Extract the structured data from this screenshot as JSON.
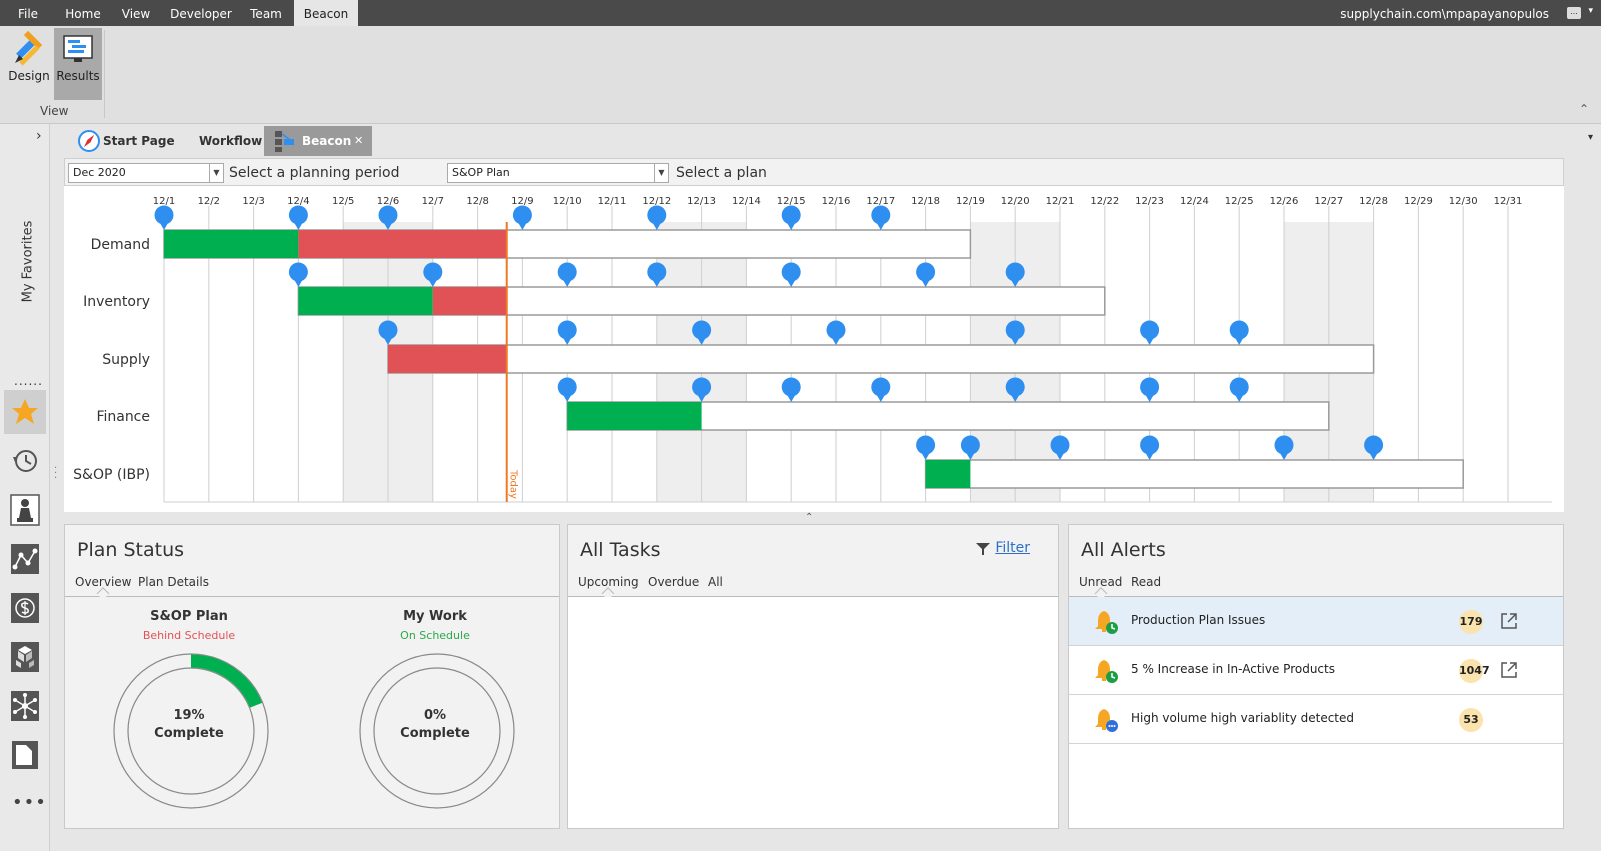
{
  "menu": {
    "items": [
      {
        "label": "File"
      },
      {
        "label": "Home"
      },
      {
        "label": "View"
      },
      {
        "label": "Developer"
      },
      {
        "label": "Team"
      },
      {
        "label": "Beacon"
      }
    ],
    "active": "Beacon",
    "user": "supplychain.com\\mpapayanopulos",
    "user_button": "...",
    "user_caret": "▾"
  },
  "ribbon": {
    "buttons": [
      {
        "label": "Design",
        "icon": "design-icon"
      },
      {
        "label": "Results",
        "icon": "results-icon",
        "selected": true
      }
    ],
    "group_label": "View",
    "collapse_glyph": "⌃"
  },
  "left_rail": {
    "expand_glyph": "›",
    "favorites_label": "My Favorites",
    "dots": "......",
    "icons": [
      "star-icon",
      "history-icon",
      "chess-pawn-icon",
      "network-graph-icon",
      "dollar-cycle-icon",
      "boxes-icon",
      "hub-icon",
      "document-icon"
    ],
    "more": "•••"
  },
  "doc_tabs": {
    "tabs": [
      {
        "label": "Start Page",
        "icon": "compass-icon"
      },
      {
        "label": "Workflow"
      },
      {
        "label": "Beacon",
        "icon": "beacon-icon",
        "selected": true,
        "closable": true
      }
    ],
    "close_glyph": "✕",
    "overflow_caret": "▾"
  },
  "selectors": {
    "period_value": "Dec 2020",
    "period_hint": "Select a planning period",
    "plan_value": "S&OP Plan",
    "plan_hint": "Select a plan",
    "dropdown_glyph": "▼"
  },
  "gantt": {
    "dates": [
      "12/1",
      "12/2",
      "12/3",
      "12/4",
      "12/5",
      "12/6",
      "12/7",
      "12/8",
      "12/9",
      "12/10",
      "12/11",
      "12/12",
      "12/13",
      "12/14",
      "12/15",
      "12/16",
      "12/17",
      "12/18",
      "12/19",
      "12/20",
      "12/21",
      "12/22",
      "12/23",
      "12/24",
      "12/25",
      "12/26",
      "12/27",
      "12/28",
      "12/29",
      "12/30",
      "12/31"
    ],
    "weekend_days": [
      5,
      6,
      12,
      13,
      19,
      20,
      26,
      27
    ],
    "today_day": 8.65,
    "today_label": "Today",
    "colors": {
      "on_track": "#00b050",
      "behind": "#e05256",
      "milestone": "#2e8ff0",
      "today": "#f07820"
    },
    "rows": [
      {
        "label": "Demand",
        "start": 1,
        "end": 19,
        "done": [
          [
            1,
            4
          ]
        ],
        "late": [
          [
            4,
            8.65
          ]
        ],
        "milestones": [
          1,
          4,
          6,
          9,
          12,
          15,
          17
        ]
      },
      {
        "label": "Inventory",
        "start": 4,
        "end": 22,
        "done": [
          [
            4,
            7
          ]
        ],
        "late": [
          [
            7,
            8.65
          ]
        ],
        "milestones": [
          4,
          7,
          10,
          12,
          15,
          18,
          20
        ]
      },
      {
        "label": "Supply",
        "start": 6,
        "end": 28,
        "done": [],
        "late": [
          [
            6,
            8.65
          ]
        ],
        "milestones": [
          6,
          10,
          13,
          16,
          20,
          23,
          25
        ]
      },
      {
        "label": "Finance",
        "start": 10,
        "end": 27,
        "done": [
          [
            10,
            13
          ]
        ],
        "late": [],
        "milestones": [
          10,
          13,
          15,
          17,
          20,
          23,
          25
        ]
      },
      {
        "label": "S&OP (IBP)",
        "start": 18,
        "end": 30,
        "done": [
          [
            18,
            19
          ]
        ],
        "late": [],
        "milestones": [
          18,
          19,
          21,
          23,
          26,
          28
        ]
      }
    ]
  },
  "splitter_glyph": "⌃",
  "plan_status": {
    "title": "Plan Status",
    "tabs": [
      "Overview",
      "Plan Details"
    ],
    "donuts": [
      {
        "title": "S&OP Plan",
        "status": "Behind Schedule",
        "status_color": "#e05256",
        "percent": 19,
        "percent_text": "19%",
        "label": "Complete",
        "fill_color": "#00b050"
      },
      {
        "title": "My Work",
        "status": "On Schedule",
        "status_color": "#2aa84a",
        "percent": 0,
        "percent_text": "0%",
        "label": "Complete",
        "fill_color": "#00b050"
      }
    ]
  },
  "all_tasks": {
    "title": "All Tasks",
    "filter_label": "Filter",
    "tabs": [
      "Upcoming",
      "Overdue",
      "All"
    ]
  },
  "all_alerts": {
    "title": "All Alerts",
    "tabs": [
      "Unread",
      "Read"
    ],
    "items": [
      {
        "text": "Production Plan Issues",
        "count": "179",
        "icon": "bell-clock-icon",
        "highlight": true,
        "link": true
      },
      {
        "text": "5 % Increase in In-Active Products",
        "count": "1047",
        "icon": "bell-clock-icon",
        "highlight": false,
        "link": true
      },
      {
        "text": "High volume high variablity detected",
        "count": "53",
        "icon": "bell-chat-icon",
        "highlight": false,
        "link": false
      }
    ]
  }
}
